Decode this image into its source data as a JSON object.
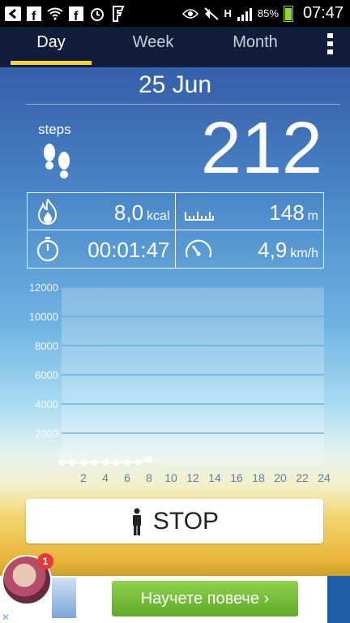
{
  "status_bar": {
    "battery": "85%",
    "time": "07:47",
    "network": "H"
  },
  "tabs": [
    {
      "label": "Day",
      "active": true
    },
    {
      "label": "Week",
      "active": false
    },
    {
      "label": "Month",
      "active": false
    }
  ],
  "date": "25 Jun",
  "steps": {
    "label": "steps",
    "value": "212"
  },
  "stats": {
    "calories": {
      "value": "8,0",
      "unit": "kcal",
      "icon": "flame-icon"
    },
    "distance": {
      "value": "148",
      "unit": "m",
      "icon": "ruler-icon"
    },
    "time": {
      "value": "00:01:47",
      "icon": "stopwatch-icon"
    },
    "speed": {
      "value": "4,9",
      "unit": "km/h",
      "icon": "speedometer-icon"
    }
  },
  "chart_data": {
    "type": "line",
    "x": [
      0,
      1,
      2,
      3,
      4,
      5,
      6,
      7,
      8
    ],
    "values": [
      0,
      0,
      0,
      0,
      0,
      0,
      0,
      0,
      212
    ],
    "xticks": [
      "2",
      "4",
      "6",
      "8",
      "10",
      "12",
      "14",
      "16",
      "18",
      "20",
      "22",
      "24"
    ],
    "yticks": [
      "12000",
      "10000",
      "8000",
      "6000",
      "4000",
      "2000"
    ],
    "ylim": [
      0,
      12000
    ],
    "xlim": [
      0,
      24
    ],
    "grid": true,
    "title": "",
    "xlabel": "",
    "ylabel": ""
  },
  "stop_button": {
    "label": "STOP"
  },
  "ad": {
    "cta": "Научете повече ›",
    "badge": "1",
    "close": "✕"
  },
  "colors": {
    "accent": "#f6d23c",
    "tabbar": "#111d3a",
    "ad_button": "#6dbb36"
  }
}
